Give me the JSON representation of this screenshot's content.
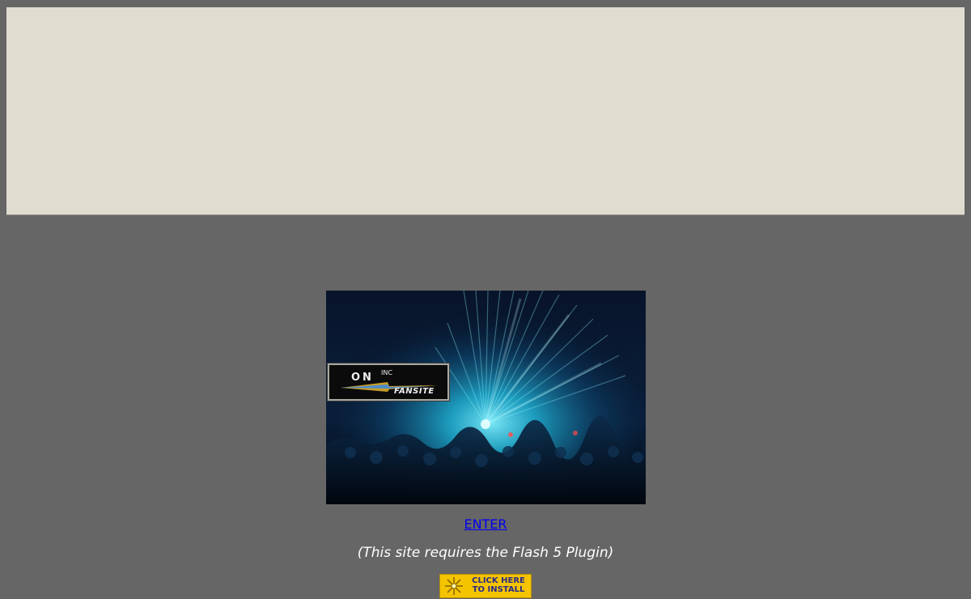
{
  "banner": {
    "background": "#e0dcd0"
  },
  "splash": {
    "logo": {
      "on_text": "ON",
      "inc_text": "INC",
      "fansite_text": "FANSITE"
    }
  },
  "enter_link": {
    "label": "ENTER",
    "color": "#0000ee"
  },
  "requires_note": {
    "text": "(This site requires the Flash 5 Plugin)"
  },
  "install_button": {
    "line1": "CLICK HERE",
    "line2": "TO INSTALL",
    "icon": "flash-player-icon",
    "background": "#f5c400"
  },
  "colors": {
    "page_background": "#666666",
    "text_note": "#ffffff"
  }
}
